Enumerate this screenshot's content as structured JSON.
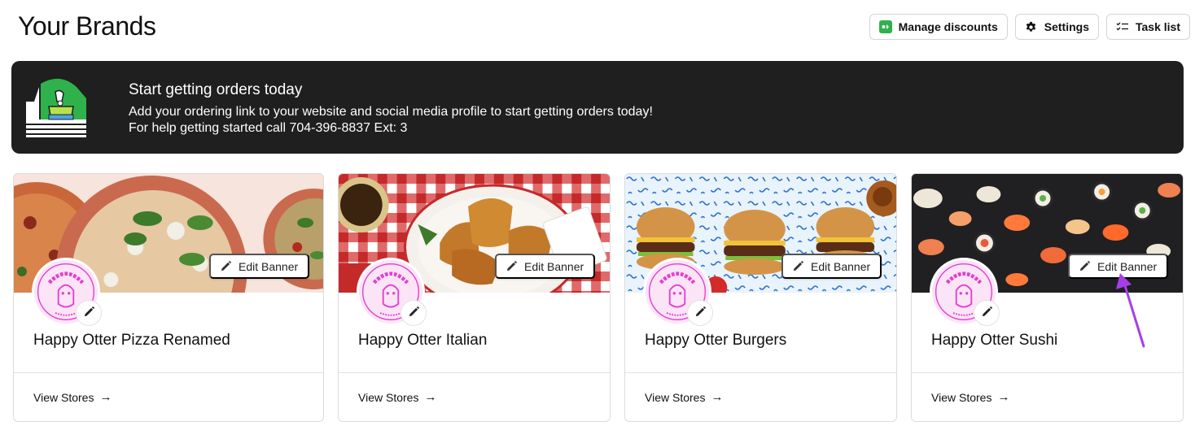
{
  "page": {
    "title": "Your Brands"
  },
  "actions": [
    {
      "label": "Manage discounts",
      "icon": "discount-icon"
    },
    {
      "label": "Settings",
      "icon": "gear-icon"
    },
    {
      "label": "Task list",
      "icon": "checklist-icon"
    }
  ],
  "promo": {
    "title": "Start getting orders today",
    "line1": "Add your ordering link to your website and social media profile to start getting orders today!",
    "line2": "For help getting started call 704-396-8837 Ext: 3"
  },
  "brands": [
    {
      "name": "Happy Otter Pizza Renamed",
      "edit_banner": "Edit Banner",
      "view_stores": "View Stores",
      "banner": "pizza"
    },
    {
      "name": "Happy Otter Italian",
      "edit_banner": "Edit Banner",
      "view_stores": "View Stores",
      "banner": "garlic-bread"
    },
    {
      "name": "Happy Otter Burgers",
      "edit_banner": "Edit Banner",
      "view_stores": "View Stores",
      "banner": "burgers"
    },
    {
      "name": "Happy Otter Sushi",
      "edit_banner": "Edit Banner",
      "view_stores": "View Stores",
      "banner": "sushi"
    }
  ],
  "logo_text": {
    "top": "HAPPY OTTER",
    "bottom": "TAQUERIA"
  },
  "colors": {
    "accent_green": "#2fb24c",
    "logo_pink": "#e23fd0",
    "annotation_purple": "#a53ee8",
    "promo_bg": "#1f1f1f"
  }
}
